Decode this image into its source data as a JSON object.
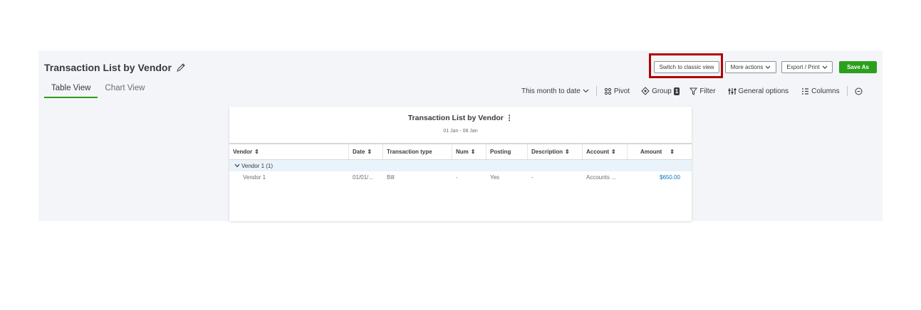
{
  "header": {
    "title": "Transaction List by Vendor",
    "tabs": [
      {
        "label": "Table View",
        "active": true
      },
      {
        "label": "Chart View",
        "active": false
      }
    ],
    "buttons": {
      "switch_classic": "Switch to classic view",
      "more_actions": "More actions",
      "export_print": "Export / Print",
      "save_as": "Save As"
    }
  },
  "toolbar": {
    "date_range": "This month to date",
    "pivot": "Pivot",
    "group": "Group",
    "group_count": "1",
    "filter": "Filter",
    "general_options": "General options",
    "columns": "Columns"
  },
  "report": {
    "title": "Transaction List by Vendor",
    "date_range": "01 Jan - 08 Jan",
    "columns": [
      "Vendor",
      "Date",
      "Transaction type",
      "Num",
      "Posting",
      "Description",
      "Account",
      "Amount"
    ],
    "group": {
      "label": "Vendor 1 (1)"
    },
    "rows": [
      {
        "vendor": "Vendor 1",
        "date": "01/01/...",
        "type": "Bill",
        "num": "-",
        "posting": "Yes",
        "description": "-",
        "account": "Accounts ...",
        "amount": "$650.00"
      }
    ]
  },
  "colors": {
    "accent": "#2ca01c",
    "highlight": "#b00000",
    "link": "#0077c5"
  }
}
